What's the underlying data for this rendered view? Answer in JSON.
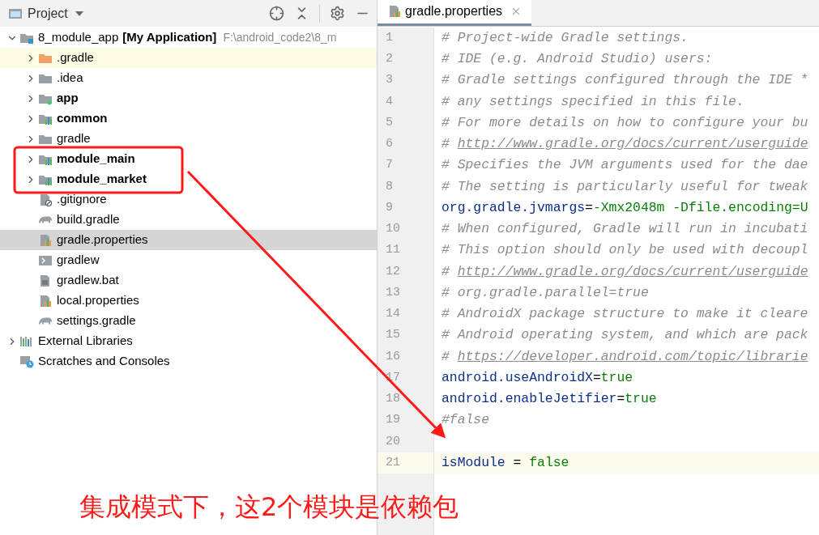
{
  "project_panel": {
    "title": "Project"
  },
  "tree": [
    {
      "name": "8_module_app",
      "tag": "[My Application]",
      "path": "F:\\android_code2\\8_m",
      "kind": "project",
      "expanded": true,
      "selected": false,
      "highlighted": false,
      "children": [
        {
          "name": ".gradle",
          "kind": "folder-excluded",
          "expanded": false,
          "selected": false,
          "highlighted": true
        },
        {
          "name": ".idea",
          "kind": "folder",
          "expanded": false,
          "selected": false,
          "highlighted": false
        },
        {
          "name": "app",
          "kind": "module-app",
          "expanded": false,
          "selected": false,
          "highlighted": false
        },
        {
          "name": "common",
          "kind": "module",
          "expanded": false,
          "selected": false,
          "highlighted": false
        },
        {
          "name": "gradle",
          "kind": "folder",
          "expanded": false,
          "selected": false,
          "highlighted": false
        },
        {
          "name": "module_main",
          "kind": "module",
          "expanded": false,
          "selected": false,
          "highlighted": false
        },
        {
          "name": "module_market",
          "kind": "module",
          "expanded": false,
          "selected": false,
          "highlighted": false
        },
        {
          "name": ".gitignore",
          "kind": "ignore-file",
          "selected": false,
          "highlighted": false
        },
        {
          "name": "build.gradle",
          "kind": "gradle-file",
          "selected": false,
          "highlighted": false
        },
        {
          "name": "gradle.properties",
          "kind": "properties-file",
          "selected": true,
          "highlighted": false
        },
        {
          "name": "gradlew",
          "kind": "shell-file",
          "selected": false,
          "highlighted": false
        },
        {
          "name": "gradlew.bat",
          "kind": "text-file",
          "selected": false,
          "highlighted": false
        },
        {
          "name": "local.properties",
          "kind": "properties-file",
          "selected": false,
          "highlighted": false
        },
        {
          "name": "settings.gradle",
          "kind": "gradle-file",
          "selected": false,
          "highlighted": false
        }
      ]
    },
    {
      "name": "External Libraries",
      "kind": "library",
      "expanded": false,
      "selected": false,
      "highlighted": false
    },
    {
      "name": "Scratches and Consoles",
      "kind": "scratches",
      "selected": false,
      "highlighted": false
    }
  ],
  "editor": {
    "tab": {
      "label": "gradle.properties",
      "selected": true
    },
    "lines": [
      {
        "number": "1",
        "current": false,
        "tokens": [
          {
            "kind": "comment",
            "text": "# Project-wide Gradle settings."
          }
        ]
      },
      {
        "number": "2",
        "current": false,
        "tokens": [
          {
            "kind": "comment",
            "text": "# IDE (e.g. Android Studio) users:"
          }
        ]
      },
      {
        "number": "3",
        "current": false,
        "tokens": [
          {
            "kind": "comment",
            "text": "# Gradle settings configured through the IDE *"
          }
        ]
      },
      {
        "number": "4",
        "current": false,
        "tokens": [
          {
            "kind": "comment",
            "text": "# any settings specified in this file."
          }
        ]
      },
      {
        "number": "5",
        "current": false,
        "tokens": [
          {
            "kind": "comment",
            "text": "# For more details on how to configure your bu"
          }
        ]
      },
      {
        "number": "6",
        "current": false,
        "tokens": [
          {
            "kind": "comment",
            "text": "# "
          },
          {
            "kind": "link",
            "text": "http://www.gradle.org/docs/current/userguide"
          }
        ]
      },
      {
        "number": "7",
        "current": false,
        "tokens": [
          {
            "kind": "comment",
            "text": "# Specifies the JVM arguments used for the dae"
          }
        ]
      },
      {
        "number": "8",
        "current": false,
        "tokens": [
          {
            "kind": "comment",
            "text": "# The setting is particularly useful for tweak"
          }
        ]
      },
      {
        "number": "9",
        "current": false,
        "tokens": [
          {
            "kind": "key",
            "text": "org.gradle.jvmargs"
          },
          {
            "kind": "op",
            "text": "="
          },
          {
            "kind": "value",
            "text": "-Xmx2048m -Dfile.encoding=U"
          }
        ]
      },
      {
        "number": "10",
        "current": false,
        "tokens": [
          {
            "kind": "comment",
            "text": "# When configured, Gradle will run in incubati"
          }
        ]
      },
      {
        "number": "11",
        "current": false,
        "tokens": [
          {
            "kind": "comment",
            "text": "# This option should only be used with decoupl"
          }
        ]
      },
      {
        "number": "12",
        "current": false,
        "tokens": [
          {
            "kind": "comment",
            "text": "# "
          },
          {
            "kind": "link",
            "text": "http://www.gradle.org/docs/current/userguide"
          }
        ]
      },
      {
        "number": "13",
        "current": false,
        "tokens": [
          {
            "kind": "comment",
            "text": "# org.gradle.parallel=true"
          }
        ]
      },
      {
        "number": "14",
        "current": false,
        "tokens": [
          {
            "kind": "comment",
            "text": "# AndroidX package structure to make it cleare"
          }
        ]
      },
      {
        "number": "15",
        "current": false,
        "tokens": [
          {
            "kind": "comment",
            "text": "# Android operating system, and which are pack"
          }
        ]
      },
      {
        "number": "16",
        "current": false,
        "tokens": [
          {
            "kind": "comment",
            "text": "# "
          },
          {
            "kind": "link",
            "text": "https://developer.android.com/topic/librarie"
          }
        ]
      },
      {
        "number": "17",
        "current": false,
        "tokens": [
          {
            "kind": "key",
            "text": "android.useAndroidX"
          },
          {
            "kind": "op",
            "text": "="
          },
          {
            "kind": "value",
            "text": "true"
          }
        ]
      },
      {
        "number": "18",
        "current": false,
        "tokens": [
          {
            "kind": "key",
            "text": "android.enableJetifier"
          },
          {
            "kind": "op",
            "text": "="
          },
          {
            "kind": "value",
            "text": "true"
          }
        ]
      },
      {
        "number": "19",
        "current": false,
        "tokens": [
          {
            "kind": "comment",
            "text": "#false"
          }
        ]
      },
      {
        "number": "20",
        "current": false
      },
      {
        "number": "21",
        "current": true,
        "tokens": [
          {
            "kind": "key",
            "text": "isModule"
          },
          {
            "kind": "op",
            "text": " = "
          },
          {
            "kind": "value",
            "text": "false"
          }
        ]
      }
    ]
  },
  "annotation": {
    "caption": "集成模式下，这2个模块是依赖包"
  }
}
